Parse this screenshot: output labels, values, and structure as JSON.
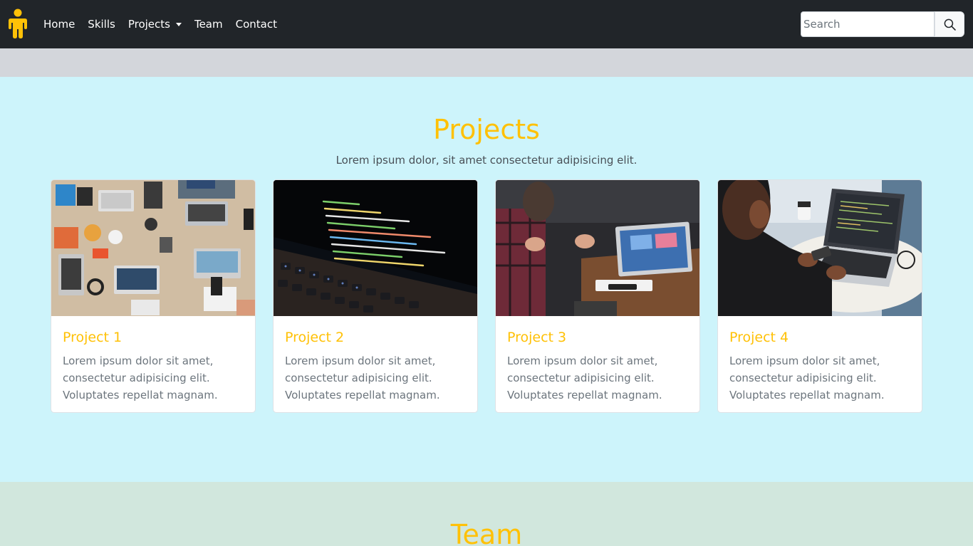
{
  "navbar": {
    "links": [
      {
        "label": "Home"
      },
      {
        "label": "Skills"
      },
      {
        "label": "Projects"
      },
      {
        "label": "Team"
      },
      {
        "label": "Contact"
      }
    ],
    "search": {
      "placeholder": "Search"
    },
    "icons": {
      "brand": "person-icon",
      "search": "search-icon",
      "dropdown": "caret-down-icon"
    }
  },
  "projects": {
    "title": "Projects",
    "subtitle": "Lorem ipsum dolor, sit amet consectetur adipisicing elit.",
    "cards": [
      {
        "title": "Project 1",
        "text": "Lorem ipsum dolor sit amet, consectetur adipisicing elit. Voluptates repellat magnam."
      },
      {
        "title": "Project 2",
        "text": "Lorem ipsum dolor sit amet, consectetur adipisicing elit. Voluptates repellat magnam."
      },
      {
        "title": "Project 3",
        "text": "Lorem ipsum dolor sit amet, consectetur adipisicing elit. Voluptates repellat magnam."
      },
      {
        "title": "Project 4",
        "text": "Lorem ipsum dolor sit amet, consectetur adipisicing elit. Voluptates repellat magnam."
      }
    ]
  },
  "team": {
    "title": "Team"
  },
  "colors": {
    "accent": "#ffc107",
    "navbar": "#212529",
    "projects_bg": "#cdf4fb",
    "team_bg": "#d1e7dd"
  }
}
